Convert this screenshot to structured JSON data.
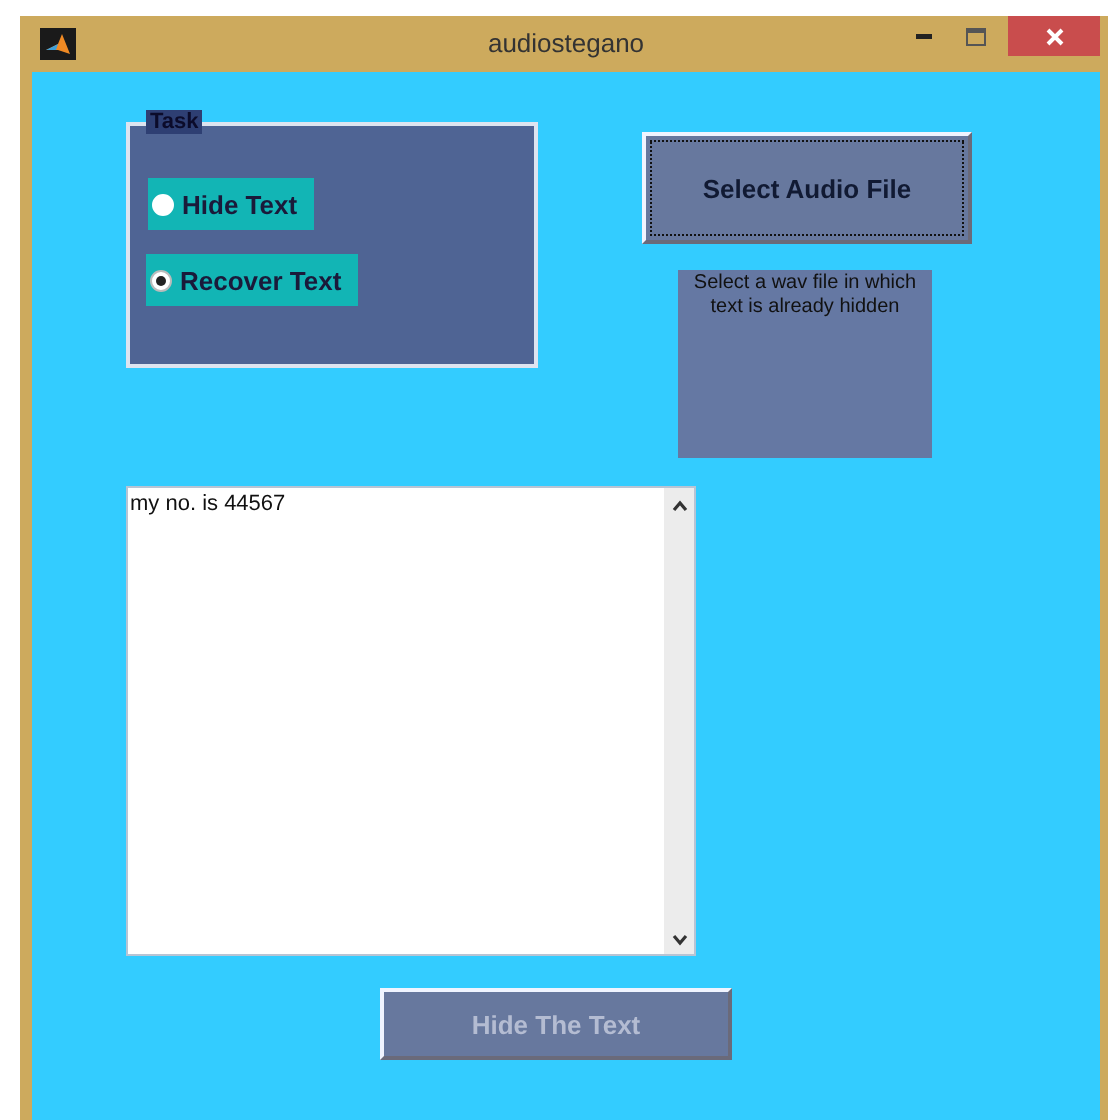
{
  "window": {
    "title": "audiostegano"
  },
  "task_panel": {
    "title": "Task",
    "options": [
      {
        "label": "Hide Text",
        "selected": false
      },
      {
        "label": "Recover Text",
        "selected": true
      }
    ]
  },
  "select_button": {
    "label": "Select Audio File",
    "focused": true,
    "disabled": false
  },
  "hint": "Select a wav file in which text is already hidden",
  "message_box": {
    "value": "my no. is 44567"
  },
  "action_button": {
    "label": "Hide The Text",
    "focused": false,
    "disabled": true
  }
}
